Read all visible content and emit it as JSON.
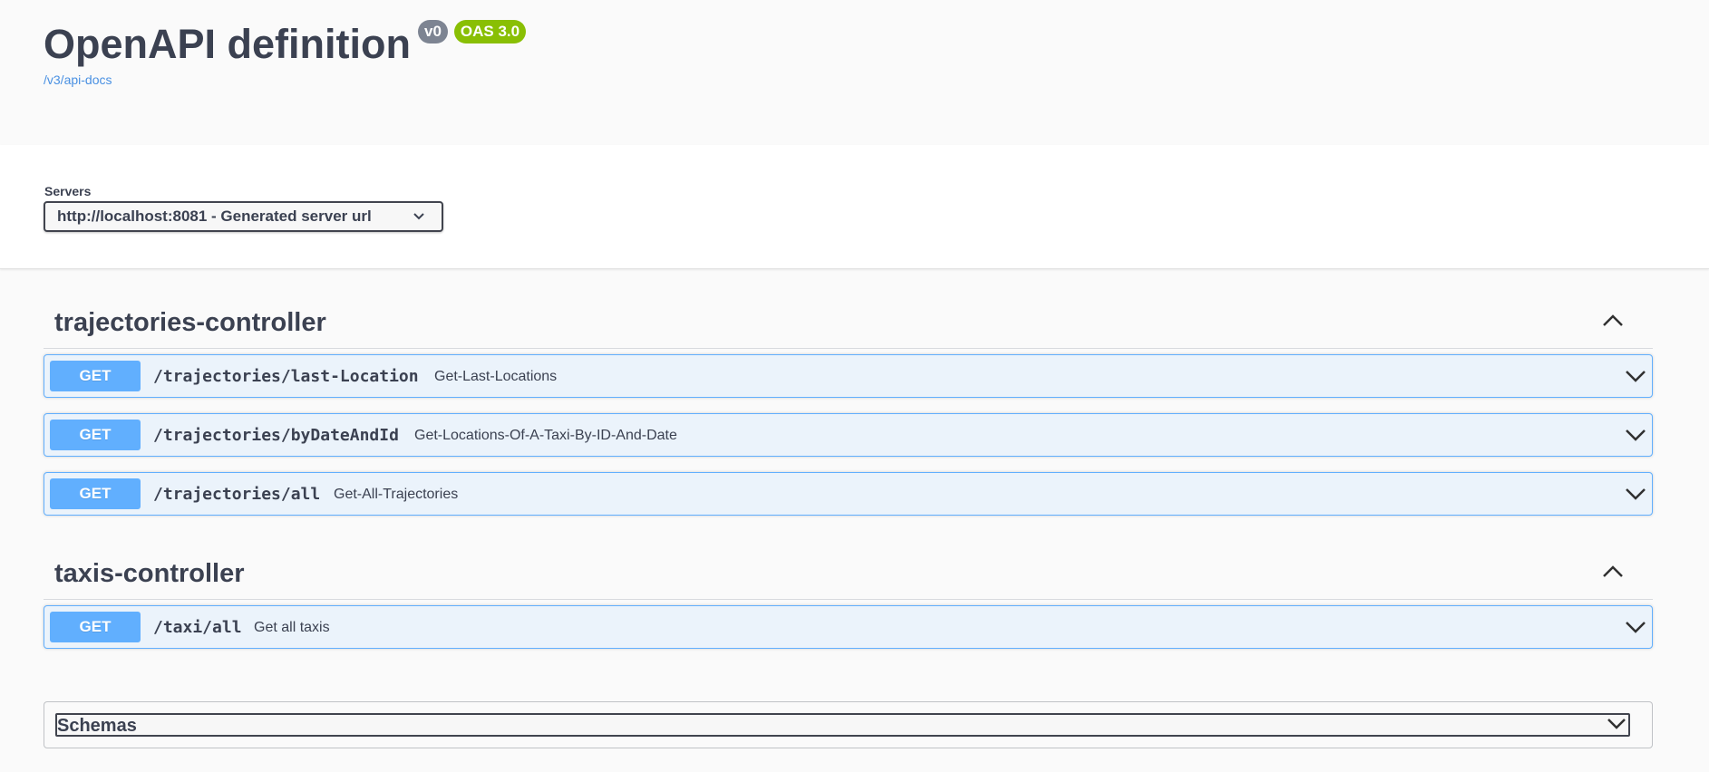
{
  "info": {
    "title": "OpenAPI definition",
    "version_badge": "v0",
    "oas_badge": "OAS 3.0",
    "docs_link": "/v3/api-docs"
  },
  "servers": {
    "label": "Servers",
    "selected": "http://localhost:8081 - Generated server url"
  },
  "tags": [
    {
      "name": "trajectories-controller",
      "operations": [
        {
          "method": "GET",
          "path": "/trajectories/last-Location",
          "summary": "Get-Last-Locations"
        },
        {
          "method": "GET",
          "path": "/trajectories/byDateAndId",
          "summary": "Get-Locations-Of-A-Taxi-By-ID-And-Date"
        },
        {
          "method": "GET",
          "path": "/trajectories/all",
          "summary": "Get-All-Trajectories"
        }
      ]
    },
    {
      "name": "taxis-controller",
      "operations": [
        {
          "method": "GET",
          "path": "/taxi/all",
          "summary": "Get all taxis"
        }
      ]
    }
  ],
  "schemas": {
    "label": "Schemas"
  },
  "colors": {
    "get_accent": "#61affe",
    "get_background": "#ebf3fb",
    "oas_badge": "#89bf04",
    "version_badge": "#7d8492",
    "link": "#4990e2"
  }
}
